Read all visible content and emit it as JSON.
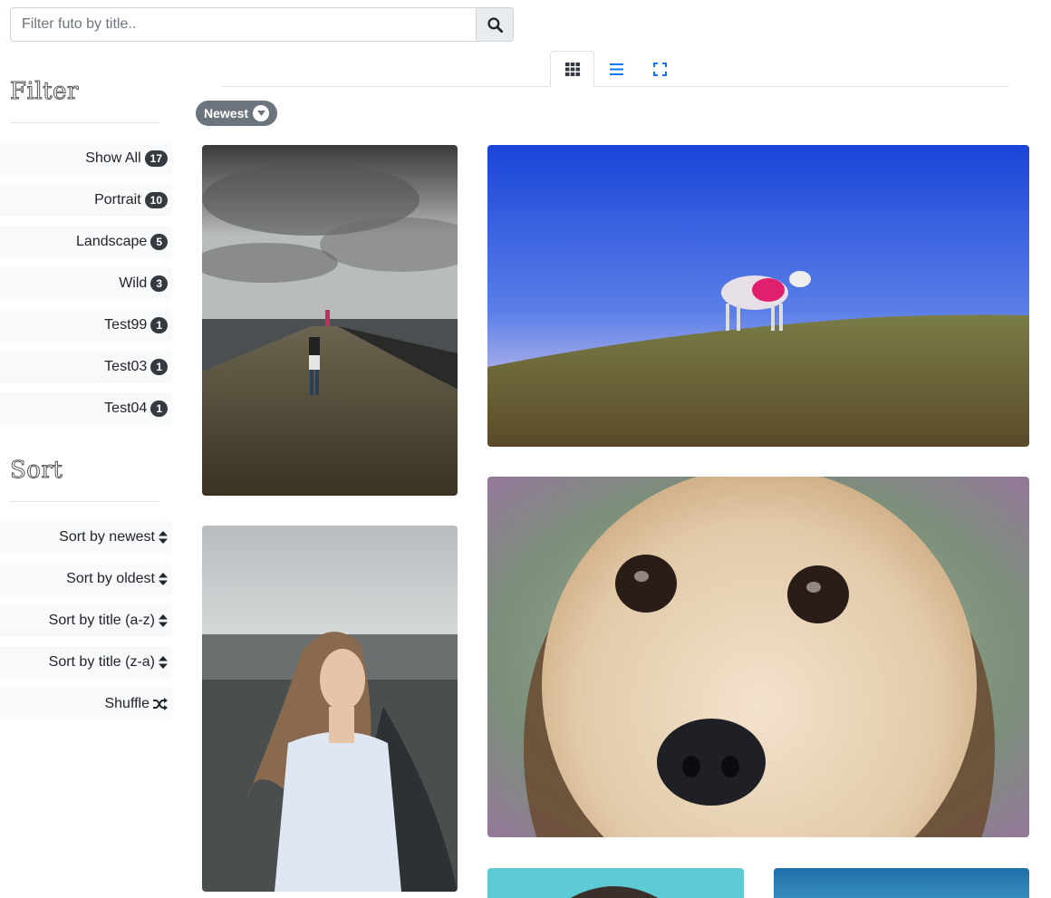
{
  "search": {
    "placeholder": "Filter futo by title..",
    "value": ""
  },
  "filter": {
    "heading": "Filter",
    "items": [
      {
        "label": "Show All",
        "count": "17"
      },
      {
        "label": "Portrait",
        "count": "10"
      },
      {
        "label": "Landscape",
        "count": "5"
      },
      {
        "label": "Wild",
        "count": "3"
      },
      {
        "label": "Test99",
        "count": "1"
      },
      {
        "label": "Test03",
        "count": "1"
      },
      {
        "label": "Test04",
        "count": "1"
      }
    ]
  },
  "sort": {
    "heading": "Sort",
    "items": [
      {
        "label": "Sort by newest",
        "icon": "sort-icon"
      },
      {
        "label": "Sort by oldest",
        "icon": "sort-icon"
      },
      {
        "label": "Sort by title (a-z)",
        "icon": "sort-icon"
      },
      {
        "label": "Sort by title (z-a)",
        "icon": "sort-icon"
      },
      {
        "label": "Shuffle",
        "icon": "shuffle-icon"
      }
    ]
  },
  "views": [
    {
      "name": "grid-view",
      "icon": "grid-icon",
      "active": true
    },
    {
      "name": "list-view",
      "icon": "list-icon",
      "active": false
    },
    {
      "name": "fullscreen-view",
      "icon": "fullscreen-icon",
      "active": false
    }
  ],
  "active_sort_pill": {
    "label": "Newest",
    "icon": "chevron-down-icon"
  },
  "photos": [
    {
      "subject": "person walking on stone pier under stormy sky"
    },
    {
      "subject": "pink-painted sheep on grassy hill under blue sky"
    },
    {
      "subject": "young woman with long hair in white t-shirt"
    },
    {
      "subject": "close-up of dog face"
    },
    {
      "subject": "person under turquoise sky"
    },
    {
      "subject": "blue sky"
    }
  ],
  "colors": {
    "accent": "#007bff",
    "badge": "#343a40",
    "pill": "#6c757d",
    "item_bg": "#f8f9fa"
  }
}
